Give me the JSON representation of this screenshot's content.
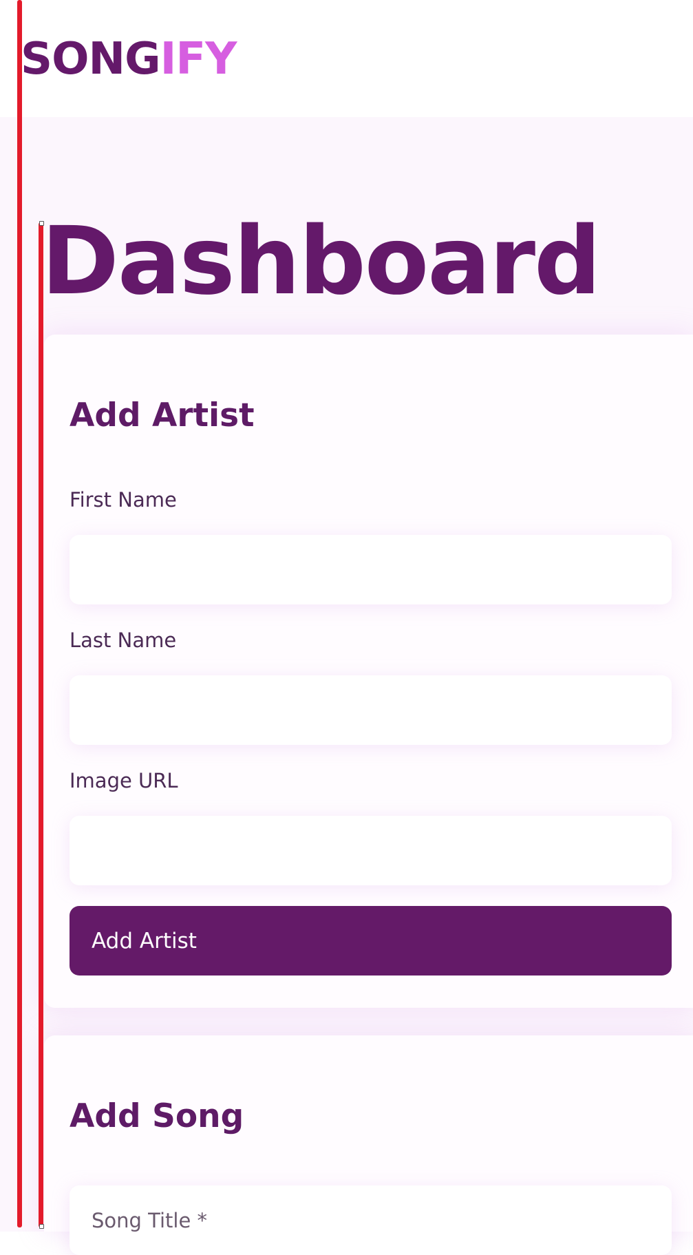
{
  "app": {
    "logo_part1": "SONG",
    "logo_part2": "IFY",
    "brand_color": "#64196a",
    "brand_accent": "#d65ee0"
  },
  "page": {
    "title": "Dashboard"
  },
  "add_artist": {
    "title": "Add Artist",
    "fields": [
      {
        "label": "First Name",
        "value": ""
      },
      {
        "label": "Last Name",
        "value": ""
      },
      {
        "label": "Image URL",
        "value": ""
      }
    ],
    "submit_label": "Add Artist",
    "button_color": "#641a68"
  },
  "add_song": {
    "title": "Add Song",
    "song_title_placeholder": "Song Title *"
  }
}
